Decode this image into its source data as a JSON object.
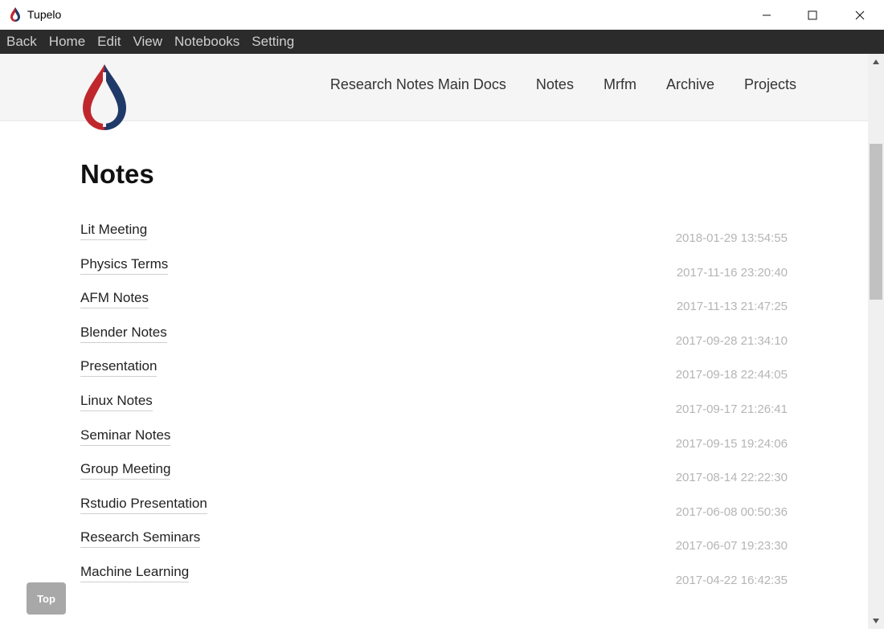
{
  "window": {
    "title": "Tupelo",
    "icon": "drop-logo-icon"
  },
  "menu": {
    "items": [
      "Back",
      "Home",
      "Edit",
      "View",
      "Notebooks",
      "Setting"
    ]
  },
  "site": {
    "nav": [
      "Research Notes Main Docs",
      "Notes",
      "Mrfm",
      "Archive",
      "Projects"
    ],
    "logo_colors": {
      "left": "#c0272d",
      "right": "#1f3a68"
    }
  },
  "page": {
    "title": "Notes"
  },
  "notes": [
    {
      "title": "Lit Meeting",
      "date": "2018-01-29 13:54:55"
    },
    {
      "title": "Physics Terms",
      "date": "2017-11-16 23:20:40"
    },
    {
      "title": "AFM Notes",
      "date": "2017-11-13 21:47:25"
    },
    {
      "title": "Blender Notes",
      "date": "2017-09-28 21:34:10"
    },
    {
      "title": "Presentation",
      "date": "2017-09-18 22:44:05"
    },
    {
      "title": "Linux Notes",
      "date": "2017-09-17 21:26:41"
    },
    {
      "title": "Seminar Notes",
      "date": "2017-09-15 19:24:06"
    },
    {
      "title": "Group Meeting",
      "date": "2017-08-14 22:22:30"
    },
    {
      "title": "Rstudio Presentation",
      "date": "2017-06-08 00:50:36"
    },
    {
      "title": "Research Seminars",
      "date": "2017-06-07 19:23:30"
    },
    {
      "title": "Machine Learning",
      "date": "2017-04-22 16:42:35"
    }
  ],
  "top_button": {
    "label": "Top"
  }
}
